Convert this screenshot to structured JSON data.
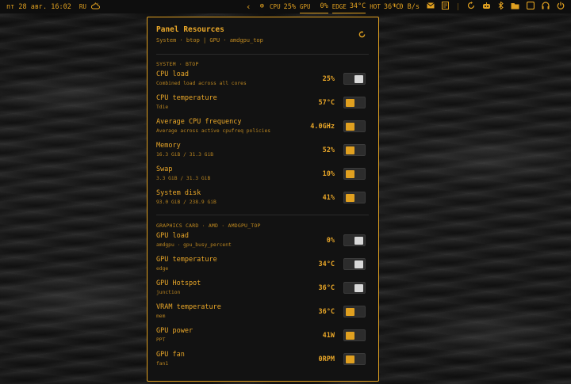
{
  "topbar": {
    "datetime": "пт 28 авг. 16:02",
    "layout": "RU",
    "left_icon": "weather-cloud-icon",
    "nav_arrow": "‹",
    "target_icon": "⊕",
    "cpu_label": "CPU",
    "cpu_value": "25%",
    "gpu_label": "GPU",
    "gpu_value": "0%",
    "edge_label": "EDGE",
    "edge_value": "34°C",
    "hot_label": "HOT",
    "hot_value": "36°C",
    "net_label": "0 B/s",
    "right_icons": [
      "mail-icon",
      "notes-icon",
      "sync-icon",
      "bot-icon",
      "bluetooth-icon",
      "folder-icon",
      "screen-icon",
      "headphones-icon",
      "power-icon"
    ]
  },
  "panel": {
    "title": "Panel Resources",
    "subtitle": "System · btop  |  GPU · amdgpu_top",
    "sections": [
      {
        "title": "SYSTEM · BTOP",
        "rows": [
          {
            "label": "CPU load",
            "desc": "Combined load across all cores",
            "value": "25%",
            "enabled": false
          },
          {
            "label": "CPU temperature",
            "desc": "Tdie",
            "value": "57°C",
            "enabled": true
          },
          {
            "label": "Average CPU frequency",
            "desc": "Average across active cpufreq policies",
            "value": "4.0GHz",
            "enabled": true
          },
          {
            "label": "Memory",
            "desc": "16.3 GiB / 31.3 GiB",
            "value": "52%",
            "enabled": true
          },
          {
            "label": "Swap",
            "desc": "3.3 GiB / 31.3 GiB",
            "value": "10%",
            "enabled": true
          },
          {
            "label": "System disk",
            "desc": "93.0 GiB / 238.9 GiB",
            "value": "41%",
            "enabled": true
          }
        ]
      },
      {
        "title": "GRAPHICS CARD · AMD · AMDGPU_TOP",
        "rows": [
          {
            "label": "GPU load",
            "desc": "amdgpu · gpu_busy_percent",
            "value": "0%",
            "enabled": false
          },
          {
            "label": "GPU temperature",
            "desc": "edge",
            "value": "34°C",
            "enabled": false
          },
          {
            "label": "GPU Hotspot",
            "desc": "junction",
            "value": "36°C",
            "enabled": false
          },
          {
            "label": "VRAM temperature",
            "desc": "mem",
            "value": "36°C",
            "enabled": true
          },
          {
            "label": "GPU power",
            "desc": "PPT",
            "value": "41W",
            "enabled": true
          },
          {
            "label": "GPU fan",
            "desc": "fan1",
            "value": "0RPM",
            "enabled": true
          }
        ]
      }
    ]
  },
  "colors": {
    "accent": "#e0a020",
    "panel_bg": "#121212",
    "toggle_off_knob": "#d8d8d8"
  }
}
